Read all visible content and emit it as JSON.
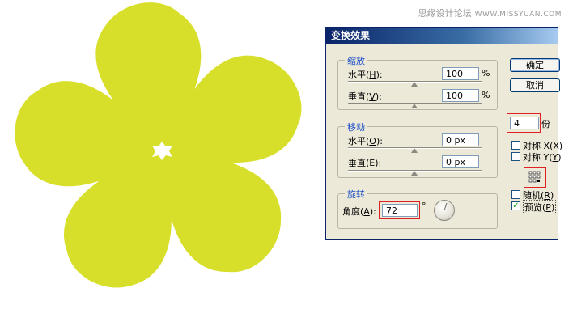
{
  "watermark": {
    "text": "思缘设计论坛",
    "site": "WWW.MISSYUAN.COM"
  },
  "flower": {
    "color": "#d8df2a",
    "petals": 5
  },
  "dialog": {
    "title": "变换效果",
    "scale": {
      "title": "缩放",
      "horizontal_label": "水平(",
      "horizontal_key": "H",
      "horizontal_end": "):",
      "horizontal_value": "100",
      "horizontal_unit": "%",
      "vertical_label": "垂直(",
      "vertical_key": "V",
      "vertical_end": "):",
      "vertical_value": "100",
      "vertical_unit": "%"
    },
    "move": {
      "title": "移动",
      "horizontal_label": "水平(",
      "horizontal_key": "O",
      "horizontal_end": "):",
      "horizontal_value": "0 px",
      "vertical_label": "垂直(",
      "vertical_key": "E",
      "vertical_end": "):",
      "vertical_value": "0 px"
    },
    "rotate": {
      "title": "旋转",
      "angle_label": "角度(",
      "angle_key": "A",
      "angle_end": "):",
      "angle_value": "72",
      "angle_unit": "°"
    },
    "ok_label": "确定",
    "cancel_label": "取消",
    "copies_value": "4",
    "copies_unit": "份",
    "reflect_x": {
      "label": "对称 X(",
      "key": "X",
      "end": ")",
      "checked": false
    },
    "reflect_y": {
      "label": "对称 Y(",
      "key": "Y",
      "end": ")",
      "checked": false
    },
    "random": {
      "label": "随机(",
      "key": "R",
      "end": ")",
      "checked": false
    },
    "preview": {
      "label": "预览(",
      "key": "P",
      "end": ")",
      "checked": true,
      "check_mark": "✓"
    },
    "highlight_color": "#e02020"
  }
}
